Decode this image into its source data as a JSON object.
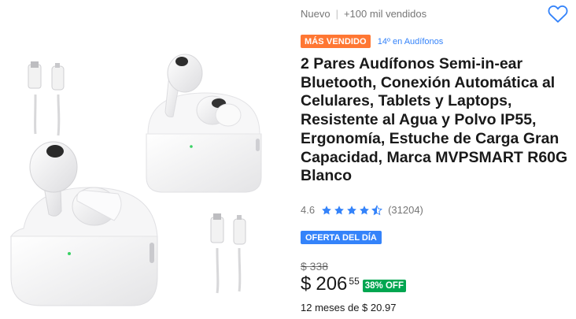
{
  "product": {
    "condition": "Nuevo",
    "separator": "|",
    "sold": "+100 mil vendidos",
    "badge_best_seller": "MÁS VENDIDO",
    "ranking": "14º en Audífonos",
    "title": "2 Pares Audífonos Semi-in-ear Bluetooth, Conexión Automática al Celulares, Tablets y Laptops, Resistente al Agua y Polvo IP55, Ergonomía, Estuche de Carga Gran Capacidad, Marca MVPSMART R60G Blanco",
    "rating_value": "4.6",
    "rating_count": "(31204)",
    "rating_stars": 4.5,
    "deal_badge": "OFERTA DEL DÍA",
    "old_price": "$ 338",
    "price_currency": "$",
    "price_integer": "206",
    "price_cents": "55",
    "discount": "38% OFF",
    "installments": "12 meses de $ 20.97"
  },
  "icons": {
    "favorite": "heart-outline-icon",
    "star": "star-icon"
  },
  "colors": {
    "accent_blue": "#3483fa",
    "best_seller_orange": "#ff7733",
    "discount_green": "#00a650"
  }
}
